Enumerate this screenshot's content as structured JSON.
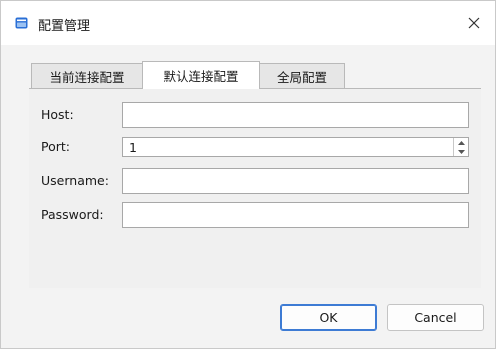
{
  "window": {
    "title": "配置管理",
    "icon": "app-window-icon",
    "close_icon": "close-icon"
  },
  "tabs": [
    {
      "label": "当前连接配置",
      "active": false
    },
    {
      "label": "默认连接配置",
      "active": true
    },
    {
      "label": "全局配置",
      "active": false
    }
  ],
  "form": {
    "host": {
      "label": "Host:",
      "value": ""
    },
    "port": {
      "label": "Port:",
      "value": "1"
    },
    "username": {
      "label": "Username:",
      "value": ""
    },
    "password": {
      "label": "Password:",
      "value": ""
    }
  },
  "buttons": {
    "ok": "OK",
    "cancel": "Cancel"
  },
  "colors": {
    "accent": "#3d7bd4",
    "icon_blue": "#2a6fd6"
  }
}
